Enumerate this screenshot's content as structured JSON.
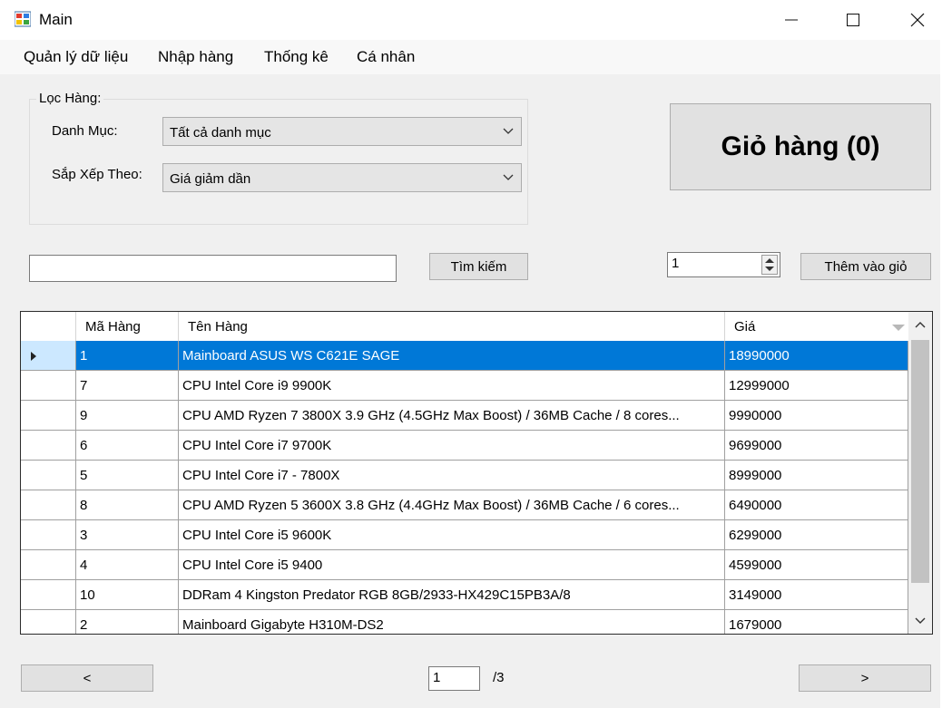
{
  "window": {
    "title": "Main"
  },
  "menu": [
    "Quản lý dữ liệu",
    "Nhập hàng",
    "Thống kê",
    "Cá nhân"
  ],
  "filter": {
    "group_label": "Lọc Hàng:",
    "category_label": "Danh Mục:",
    "category_value": "Tất cả danh mục",
    "sort_label": "Sắp Xếp Theo:",
    "sort_value": "Giá giảm dần"
  },
  "cart_button": "Giỏ hàng (0)",
  "search": {
    "value": "",
    "button": "Tìm kiếm"
  },
  "quantity": {
    "value": "1"
  },
  "add_button": "Thêm vào giỏ",
  "table": {
    "columns": [
      "Mã Hàng",
      "Tên Hàng",
      "Giá"
    ],
    "rows": [
      {
        "id": "1",
        "name": "Mainboard ASUS WS C621E SAGE",
        "price": "18990000"
      },
      {
        "id": "7",
        "name": "CPU Intel Core i9 9900K",
        "price": "12999000"
      },
      {
        "id": "9",
        "name": "CPU AMD Ryzen 7 3800X 3.9 GHz (4.5GHz Max Boost) / 36MB Cache / 8 cores...",
        "price": "9990000"
      },
      {
        "id": "6",
        "name": "CPU Intel Core i7 9700K",
        "price": "9699000"
      },
      {
        "id": "5",
        "name": "CPU Intel Core i7 - 7800X",
        "price": "8999000"
      },
      {
        "id": "8",
        "name": "CPU AMD Ryzen 5 3600X 3.8 GHz (4.4GHz Max Boost) / 36MB Cache / 6 cores...",
        "price": "6490000"
      },
      {
        "id": "3",
        "name": "CPU Intel Core i5 9600K",
        "price": "6299000"
      },
      {
        "id": "4",
        "name": "CPU Intel Core i5 9400",
        "price": "4599000"
      },
      {
        "id": "10",
        "name": "DDRam 4 Kingston Predator RGB 8GB/2933-HX429C15PB3A/8",
        "price": "3149000"
      },
      {
        "id": "2",
        "name": "Mainboard Gigabyte H310M-DS2",
        "price": "1679000"
      }
    ]
  },
  "pager": {
    "prev": "<",
    "next": ">",
    "current": "1",
    "total": "/3"
  }
}
